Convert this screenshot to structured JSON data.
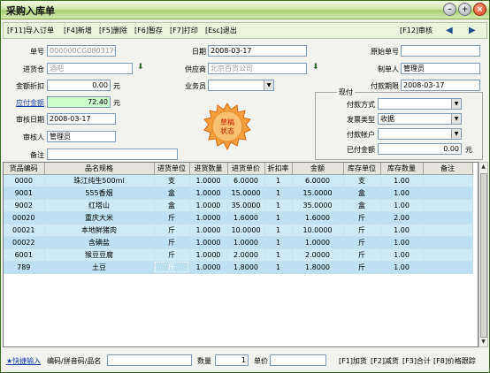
{
  "window": {
    "title": "采购入库单"
  },
  "toolbar": {
    "import_order": "[F11]导入订单",
    "add": "[F4]新增",
    "delete": "[F5]删除",
    "hold": "[F6]暂存",
    "print": "[F7]打印",
    "exit": "[Esc]退出",
    "audit": "[F12]审核"
  },
  "form": {
    "order_no_label": "单号",
    "order_no": "000000CG0803170003",
    "date_label": "日期",
    "date": "2008-03-17",
    "orig_no_label": "原始单号",
    "orig_no": "",
    "warehouse_label": "进货仓",
    "warehouse": "酒吧",
    "supplier_label": "供应商",
    "supplier": "北京百货公司",
    "creator_label": "制单人",
    "creator": "管理员",
    "discount_label": "金额折扣",
    "discount": "0.00",
    "discount_unit": "元",
    "salesman_label": "业务员",
    "salesman": "",
    "pay_due_label": "付款期限",
    "pay_due": "2008-03-17",
    "payable_label": "应付金额",
    "payable": "72.40",
    "payable_unit": "元",
    "audit_date_label": "审核日期",
    "audit_date": "2008-03-17",
    "auditor_label": "审核人",
    "auditor": "管理员",
    "remark_label": "备注",
    "remark": ""
  },
  "payment": {
    "legend": "现付",
    "method_label": "付款方式",
    "method": "",
    "invoice_label": "发票类型",
    "invoice": "收据",
    "account_label": "付款帐户",
    "account": "",
    "paid_label": "已付金额",
    "paid": "0.00",
    "paid_unit": "元"
  },
  "stamp": {
    "line1": "草稿",
    "line2": "状态"
  },
  "grid": {
    "headers": [
      "货品编码",
      "品名规格",
      "进货单位",
      "进货数量",
      "进货单价",
      "折扣率",
      "金额",
      "库存单位",
      "库存数量",
      "备注"
    ],
    "rows": [
      [
        "0000",
        "珠江纯生500ml",
        "支",
        "1.0000",
        "6.0000",
        "1",
        "6.0000",
        "支",
        "1.00",
        ""
      ],
      [
        "9001",
        "555香烟",
        "盒",
        "1.0000",
        "15.0000",
        "1",
        "15.0000",
        "盒",
        "1.00",
        ""
      ],
      [
        "9002",
        "红塔山",
        "盒",
        "1.0000",
        "35.0000",
        "1",
        "35.0000",
        "盒",
        "1.00",
        ""
      ],
      [
        "00020",
        "重庆大米",
        "斤",
        "1.0000",
        "1.6000",
        "1",
        "1.6000",
        "斤",
        "2.00",
        ""
      ],
      [
        "00021",
        "本地鲜猪肉",
        "斤",
        "1.0000",
        "10.0000",
        "1",
        "10.0000",
        "斤",
        "1.00",
        ""
      ],
      [
        "00022",
        "含碘盐",
        "斤",
        "1.0000",
        "1.0000",
        "1",
        "1.0000",
        "斤",
        "1.00",
        ""
      ],
      [
        "6001",
        "猴豆豆腐",
        "斤",
        "1.0000",
        "2.0000",
        "1",
        "2.0000",
        "斤",
        "1.00",
        ""
      ],
      [
        "789",
        "土豆",
        "斤",
        "1.0000",
        "1.8000",
        "1",
        "1.8000",
        "斤",
        "1.00",
        ""
      ]
    ]
  },
  "bottom": {
    "quick_input": "★快捷输入",
    "code_label": "编码/拼音码/品名",
    "qty_label": "数量",
    "qty": "1",
    "price_label": "单价",
    "price": "",
    "add_qty": "[F1]加货",
    "reduce_qty": "[F2]减货",
    "total": "[F3]合计",
    "price_trace": "[F8]价格跟踪"
  }
}
